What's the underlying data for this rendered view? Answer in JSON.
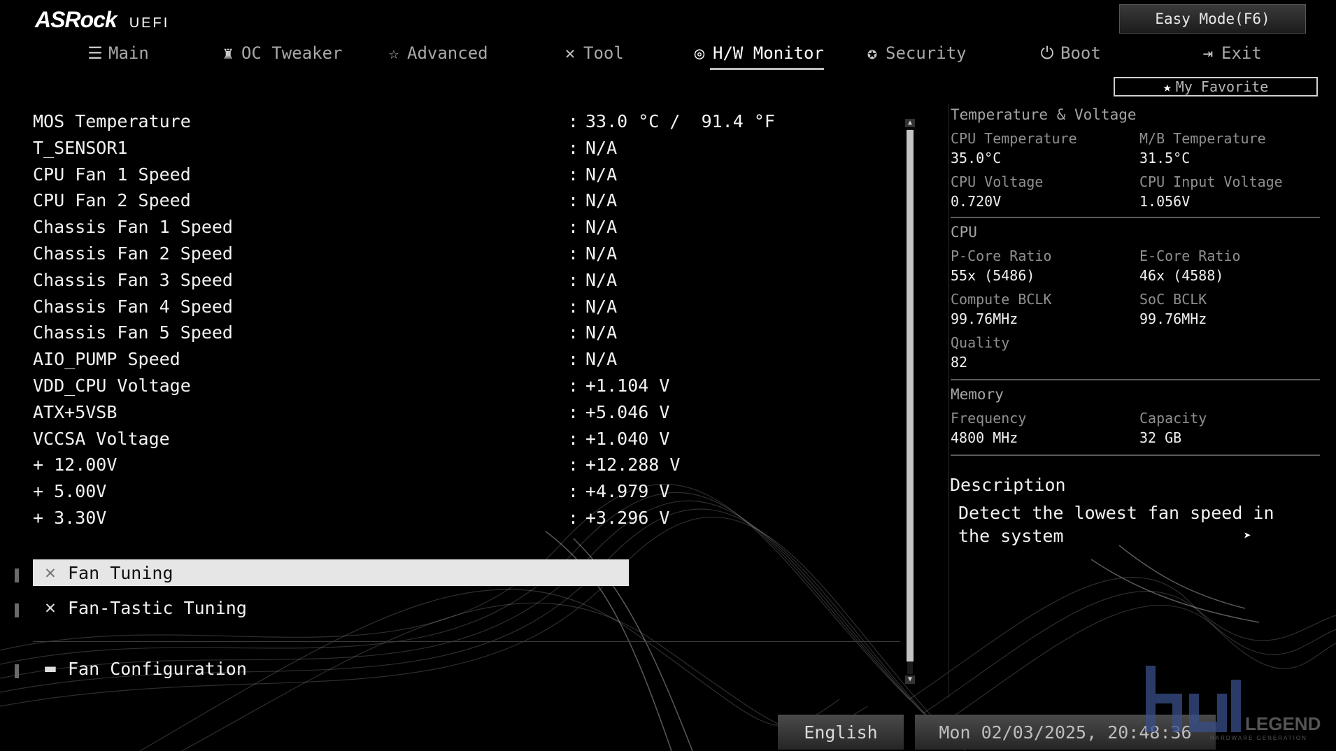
{
  "brand": {
    "logo": "ASRock",
    "suffix": "UEFI"
  },
  "easy_mode_button": "Easy Mode(F6)",
  "nav": [
    {
      "icon": "list-icon",
      "glyph": "☰",
      "label": "Main",
      "active": false
    },
    {
      "icon": "rocket-icon",
      "glyph": "♜",
      "label": "OC Tweaker",
      "active": false
    },
    {
      "icon": "star-icon",
      "glyph": "☆",
      "label": "Advanced",
      "active": false
    },
    {
      "icon": "tools-icon",
      "glyph": "✕",
      "label": "Tool",
      "active": false
    },
    {
      "icon": "monitor-gauge-icon",
      "glyph": "◎",
      "label": "H/W Monitor",
      "active": true
    },
    {
      "icon": "shield-icon",
      "glyph": "✪",
      "label": "Security",
      "active": false
    },
    {
      "icon": "power-icon",
      "glyph": "⏻",
      "label": "Boot",
      "active": false
    },
    {
      "icon": "exit-door-icon",
      "glyph": "⇥",
      "label": "Exit",
      "active": false
    }
  ],
  "favorite": {
    "label": "My Favorite"
  },
  "readings": [
    {
      "label": "MOS Temperature",
      "value": "33.0 °C /  91.4 °F"
    },
    {
      "label": "T_SENSOR1",
      "value": "N/A"
    },
    {
      "label": "CPU Fan 1 Speed",
      "value": "N/A"
    },
    {
      "label": "CPU Fan 2 Speed",
      "value": "N/A"
    },
    {
      "label": "Chassis Fan 1 Speed",
      "value": "N/A"
    },
    {
      "label": "Chassis Fan 2 Speed",
      "value": "N/A"
    },
    {
      "label": "Chassis Fan 3 Speed",
      "value": "N/A"
    },
    {
      "label": "Chassis Fan 4 Speed",
      "value": "N/A"
    },
    {
      "label": "Chassis Fan 5 Speed",
      "value": "N/A"
    },
    {
      "label": "AIO_PUMP Speed",
      "value": "N/A"
    },
    {
      "label": "VDD_CPU Voltage",
      "value": "+1.104 V"
    },
    {
      "label": "ATX+5VSB",
      "value": "+5.046 V"
    },
    {
      "label": "VCCSA Voltage",
      "value": "+1.040 V"
    },
    {
      "label": "+ 12.00V",
      "value": "+12.288 V"
    },
    {
      "label": "+ 5.00V",
      "value": "+4.979 V"
    },
    {
      "label": "+ 3.30V",
      "value": "+3.296 V"
    }
  ],
  "colon": ":",
  "menu": [
    {
      "icon": "tools-icon",
      "glyph": "✕",
      "label": "Fan Tuning",
      "selected": true
    },
    {
      "icon": "tools-icon",
      "glyph": "✕",
      "label": "Fan-Tastic Tuning",
      "selected": false
    },
    {
      "icon": "folder-icon",
      "glyph": "▬",
      "label": "Fan Configuration",
      "selected": false
    }
  ],
  "sidebar": {
    "temp_voltage": {
      "heading": "Temperature & Voltage",
      "items": [
        {
          "label": "CPU Temperature",
          "value": "35.0°C"
        },
        {
          "label": "M/B Temperature",
          "value": "31.5°C"
        },
        {
          "label": "CPU Voltage",
          "value": "0.720V"
        },
        {
          "label": "CPU Input Voltage",
          "value": "1.056V"
        }
      ]
    },
    "cpu": {
      "heading": "CPU",
      "items": [
        {
          "label": "P-Core Ratio",
          "value": "55x (5486)"
        },
        {
          "label": "E-Core Ratio",
          "value": "46x (4588)"
        },
        {
          "label": "Compute BCLK",
          "value": "99.76MHz"
        },
        {
          "label": "SoC BCLK",
          "value": "99.76MHz"
        },
        {
          "label": "Quality",
          "value": "82"
        }
      ]
    },
    "memory": {
      "heading": "Memory",
      "items": [
        {
          "label": "Frequency",
          "value": "4800 MHz"
        },
        {
          "label": "Capacity",
          "value": "32 GB"
        }
      ]
    }
  },
  "description": {
    "title": "Description",
    "text": "Detect the lowest fan speed in the system"
  },
  "footer": {
    "language": "English",
    "datetime": "Mon 02/03/2025, 20:48:36"
  },
  "watermark": {
    "text": "LEGEND",
    "subtext": "HARDWARE GENERATION"
  }
}
